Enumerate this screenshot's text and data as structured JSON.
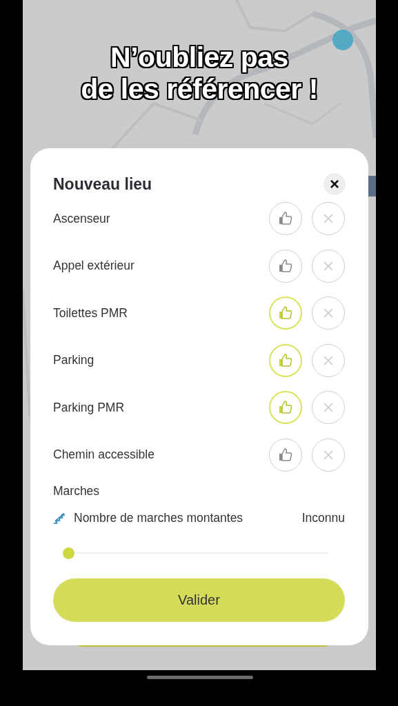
{
  "caption": [
    "N’oubliez pas",
    "de les référencer !"
  ],
  "dialog": {
    "title": "Nouveau lieu",
    "close": "×",
    "features": [
      {
        "label": "Ascenseur",
        "liked": false,
        "disliked": false
      },
      {
        "label": "Appel extérieur",
        "liked": false,
        "disliked": false
      },
      {
        "label": "Toilettes PMR",
        "liked": true,
        "disliked": false
      },
      {
        "label": "Parking",
        "liked": true,
        "disliked": false
      },
      {
        "label": "Parking PMR",
        "liked": true,
        "disliked": false
      },
      {
        "label": "Chemin accessible",
        "liked": false,
        "disliked": false
      }
    ],
    "section": "Marches",
    "steps": {
      "label": "Nombre de marches montantes",
      "value": "Inconnu",
      "level": 0
    },
    "submit": "Valider"
  }
}
